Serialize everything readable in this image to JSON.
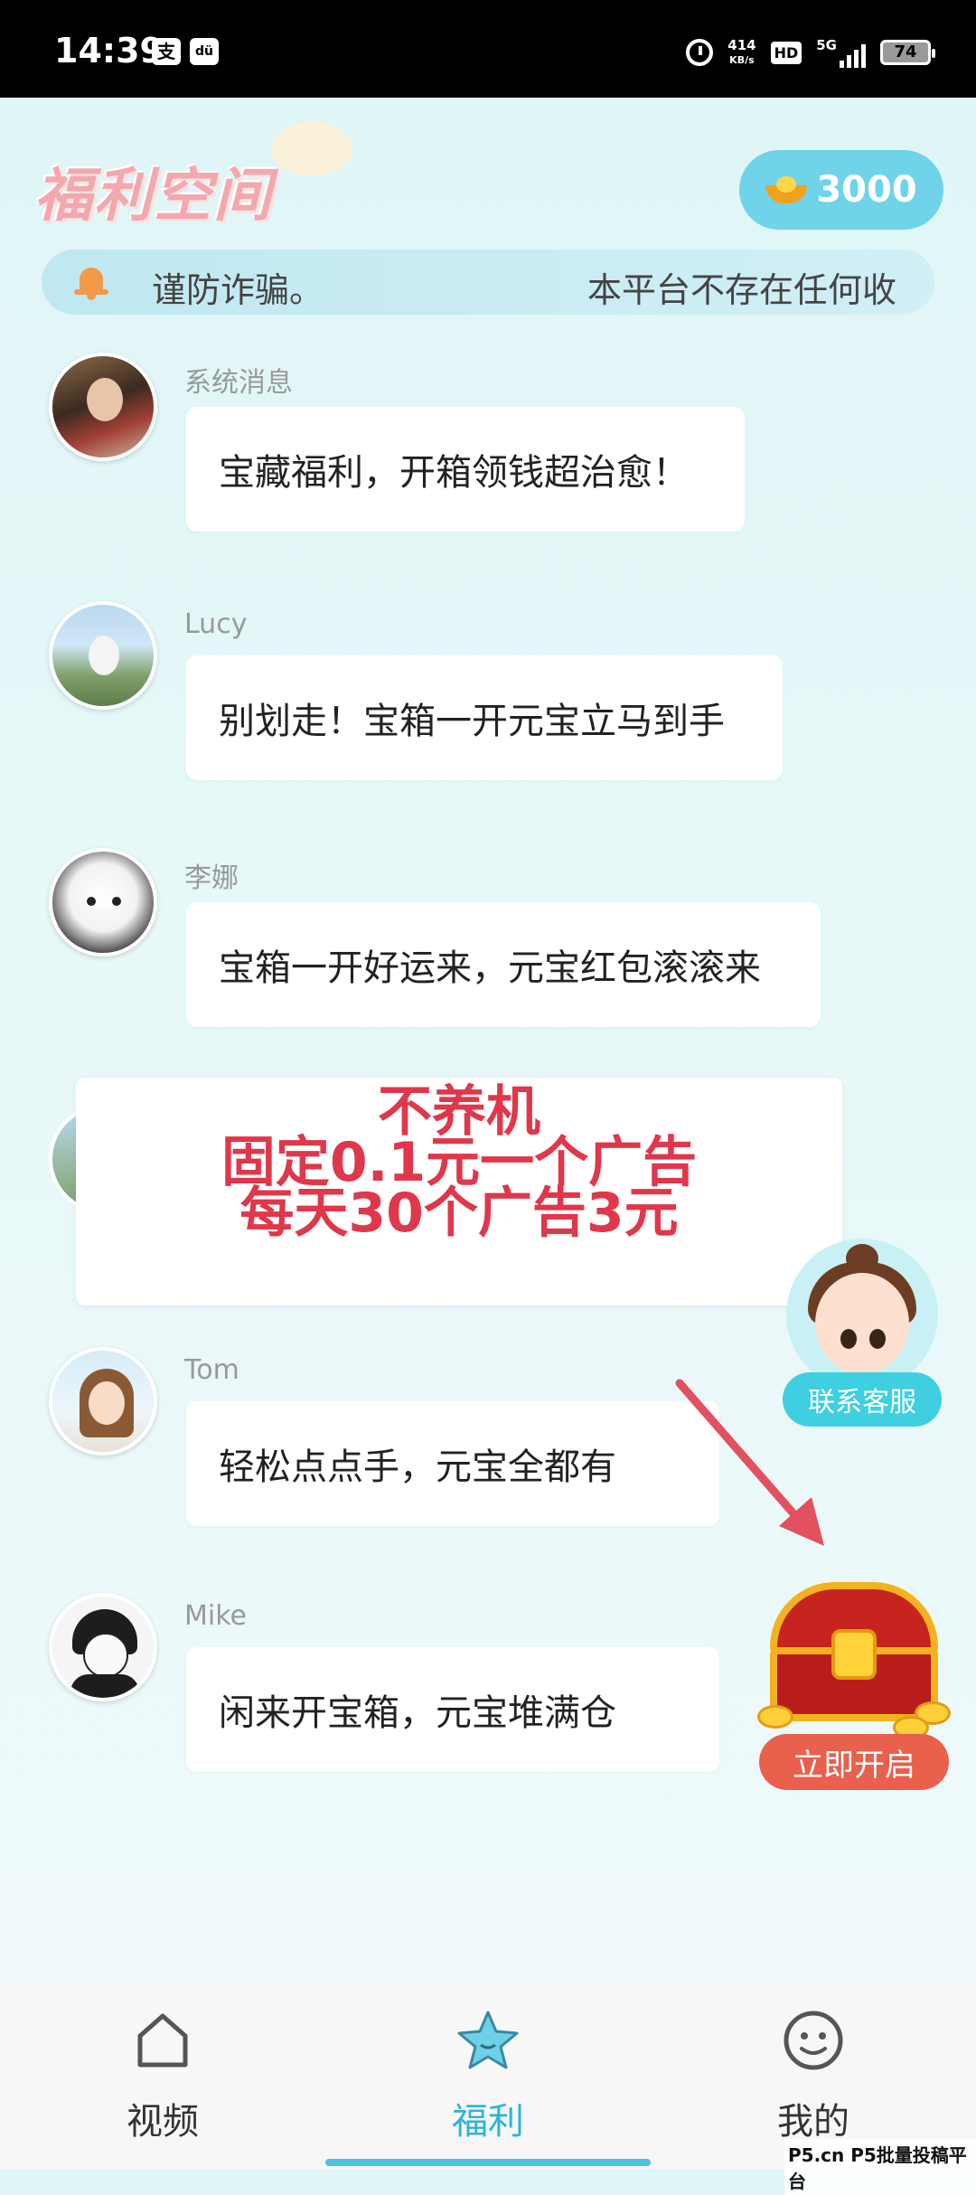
{
  "status_bar": {
    "time": "14:39",
    "app_icon_1": "支",
    "app_icon_2": "dü",
    "net_speed_value": "414",
    "net_speed_unit": "KB/s",
    "hd_badge": "HD",
    "network": "5G",
    "battery": "74"
  },
  "header": {
    "logo_text": "福利空间",
    "coin_balance": "3000"
  },
  "notice": {
    "text_a": "谨防诈骗。",
    "text_b": "本平台不存在任何收"
  },
  "messages": [
    {
      "name": "系统消息",
      "text": "宝藏福利，开箱领钱超治愈！"
    },
    {
      "name": "Lucy",
      "text": "别划走！宝箱一开元宝立马到手"
    },
    {
      "name": "李娜",
      "text": "宝箱一开好运来，元宝红包滚滚来"
    },
    {
      "name": "Tom",
      "text": "轻松点点手，元宝全都有"
    },
    {
      "name": "Mike",
      "text": "闲来开宝箱，元宝堆满仓"
    }
  ],
  "promo": {
    "line1": "不养机",
    "line2": "固定0.1元一个广告",
    "line3": "每天30个广告3元"
  },
  "customer_service": {
    "label": "联系客服"
  },
  "treasure": {
    "button_label": "立即开启"
  },
  "bottom_nav": [
    {
      "label": "视频",
      "icon": "video-icon",
      "active": false
    },
    {
      "label": "福利",
      "icon": "star-icon",
      "active": true
    },
    {
      "label": "我的",
      "icon": "smiley-icon",
      "active": false
    }
  ],
  "watermark": "P5.cn P5批量投稿平台",
  "colors": {
    "accent": "#2bb5d6",
    "coin_pill": "#6fd3ea",
    "promo_text": "#e0374a",
    "open_button": "#e9604c",
    "arrow": "#e3505f"
  }
}
